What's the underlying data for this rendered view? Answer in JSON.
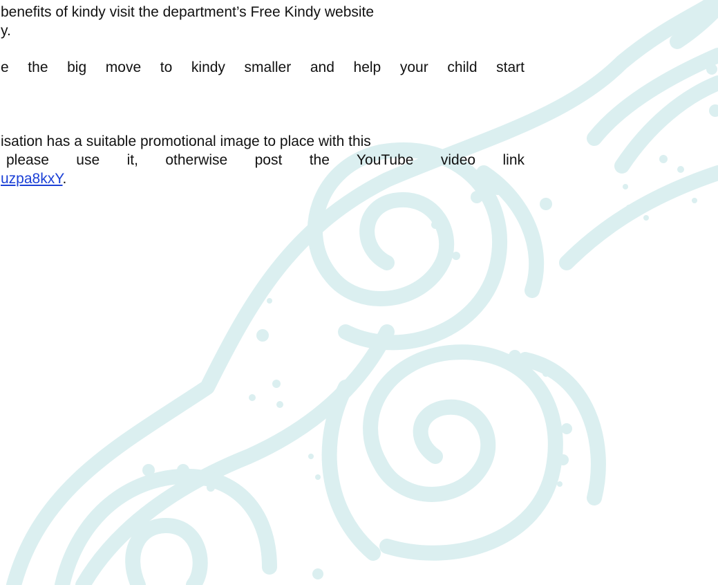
{
  "document": {
    "paragraph1": {
      "line1": "benefits of kindy visit the department’s Free Kindy website",
      "line2": "y."
    },
    "paragraph2": {
      "line1": "e the big move to kindy smaller and help your child start"
    },
    "paragraph3": {
      "line1": "isation has a suitable promotional image to place with this",
      "line2": "please use it, otherwise post the YouTube video link",
      "link_text": "uzpa8kxY",
      "line3_suffix": "."
    }
  },
  "decoration": {
    "motif": "teal-swirl-watermark",
    "color": "#dbeff0"
  }
}
